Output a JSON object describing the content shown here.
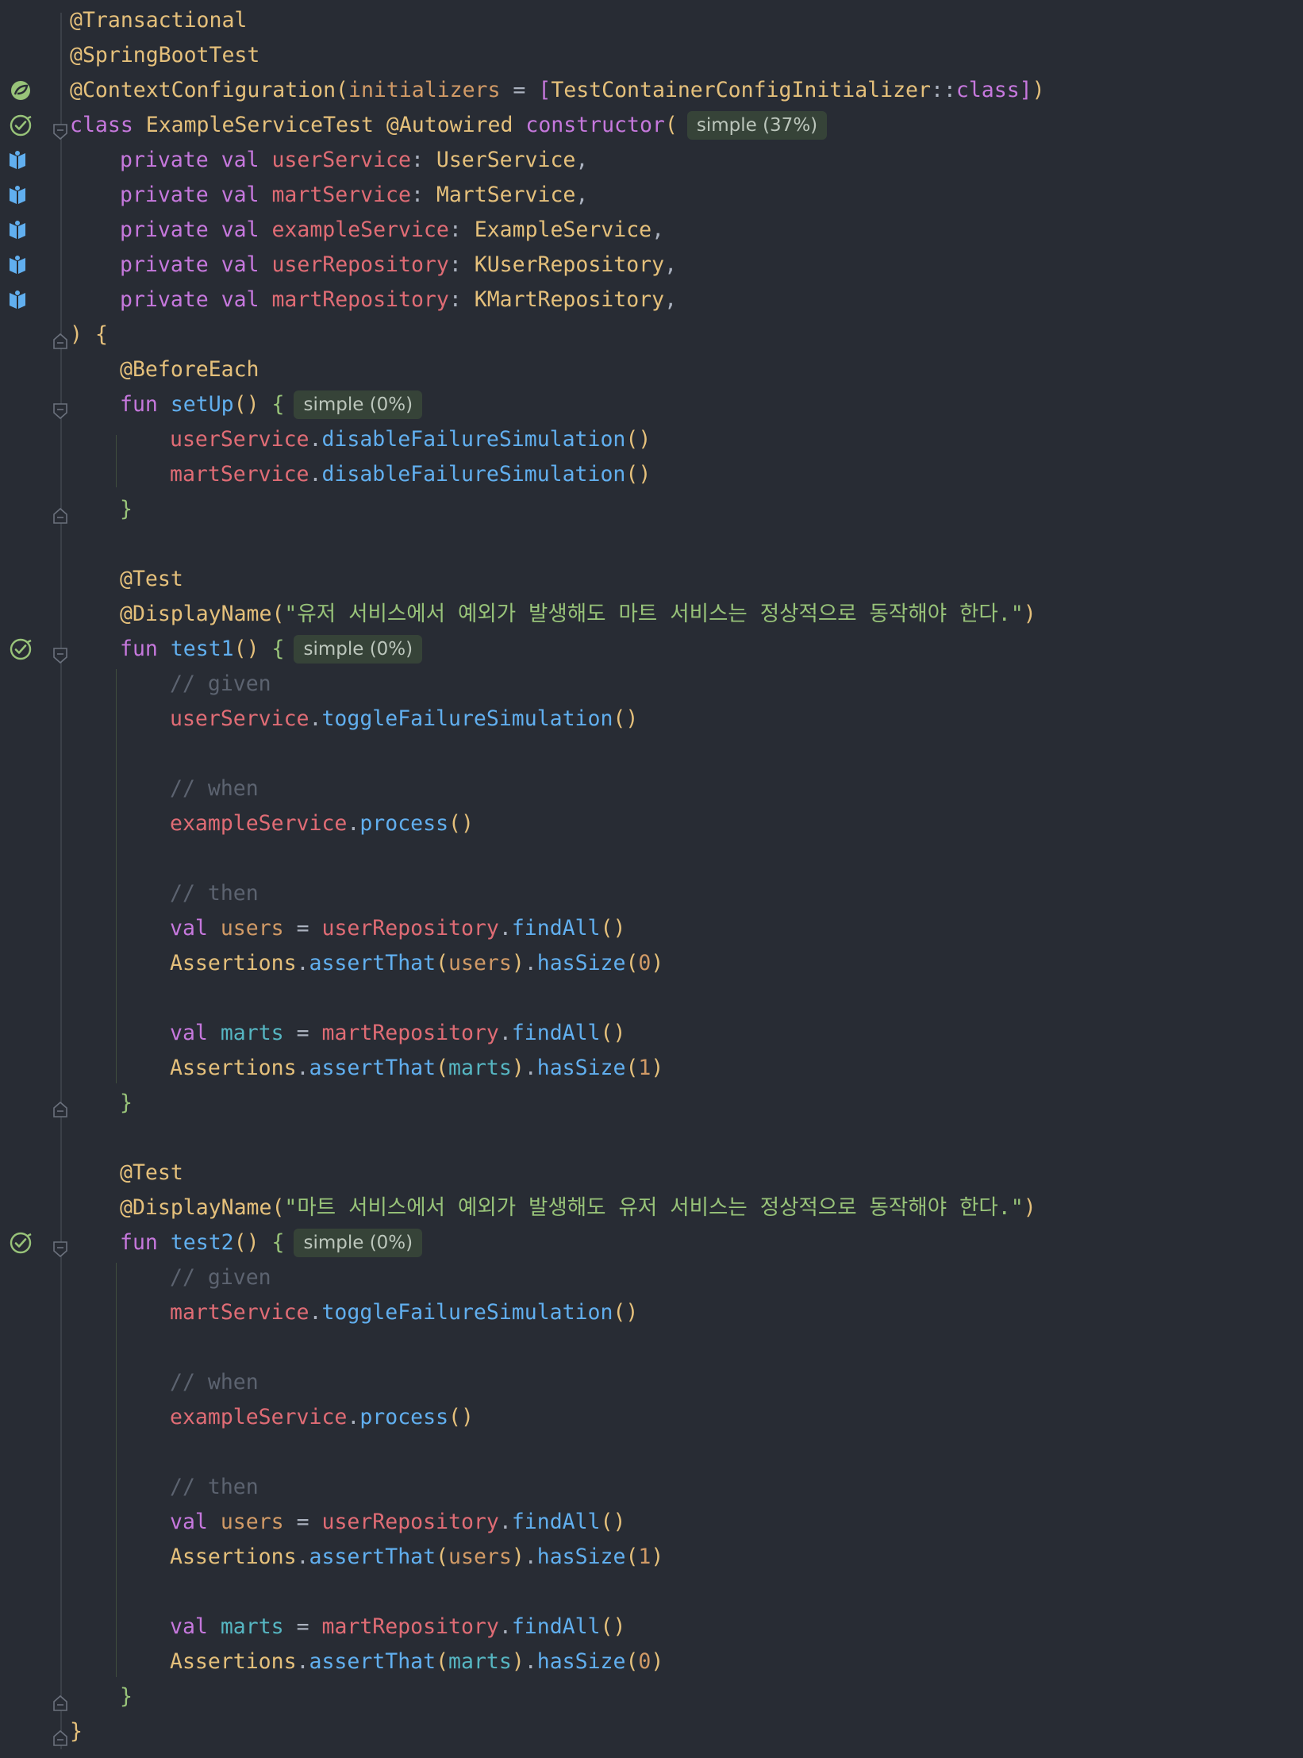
{
  "colors": {
    "background": "#282c34",
    "keyword": "#c678dd",
    "annotation": "#e5c07b",
    "type": "#e5c07b",
    "property": "#e06c75",
    "function": "#61afef",
    "string": "#98c379",
    "comment": "#5c6370",
    "number": "#d19a66",
    "plain": "#abb2bf",
    "bracket_outer": "#e5c07b",
    "bracket_inner": "#c678dd",
    "brace": "#98c379",
    "gutter_run": "#98c379",
    "gutter_inject": "#61afef"
  },
  "lines": [
    {
      "gutter": null,
      "fold": null,
      "indent": 0,
      "tokens": [
        {
          "t": "@Transactional",
          "c": "annotation"
        }
      ]
    },
    {
      "gutter": null,
      "fold": null,
      "indent": 0,
      "tokens": [
        {
          "t": "@SpringBootTest",
          "c": "annotation"
        }
      ]
    },
    {
      "gutter": "spring-bean-icon",
      "fold": null,
      "indent": 0,
      "tokens": [
        {
          "t": "@ContextConfiguration",
          "c": "annotation"
        },
        {
          "t": "(",
          "c": "bracket_outer"
        },
        {
          "t": "initializers",
          "c": "number"
        },
        {
          "t": " = ",
          "c": "plain"
        },
        {
          "t": "[",
          "c": "bracket_inner"
        },
        {
          "t": "TestContainerConfigInitializer",
          "c": "type"
        },
        {
          "t": "::",
          "c": "plain"
        },
        {
          "t": "class",
          "c": "keyword"
        },
        {
          "t": "]",
          "c": "bracket_inner"
        },
        {
          "t": ")",
          "c": "bracket_outer"
        }
      ]
    },
    {
      "gutter": "run-test-icon",
      "fold": "fold-open-icon",
      "indent": 0,
      "tokens": [
        {
          "t": "class ",
          "c": "keyword"
        },
        {
          "t": "ExampleServiceTest ",
          "c": "type"
        },
        {
          "t": "@Autowired ",
          "c": "annotation"
        },
        {
          "t": "constructor",
          "c": "keyword"
        },
        {
          "t": "(",
          "c": "bracket_outer"
        }
      ],
      "hint": "simple (37%)"
    },
    {
      "gutter": "autowired-icon",
      "fold": null,
      "indent": 1,
      "tokens": [
        {
          "t": "private val ",
          "c": "keyword"
        },
        {
          "t": "userService",
          "c": "property"
        },
        {
          "t": ": ",
          "c": "plain"
        },
        {
          "t": "UserService",
          "c": "type"
        },
        {
          "t": ",",
          "c": "plain"
        }
      ]
    },
    {
      "gutter": "autowired-icon",
      "fold": null,
      "indent": 1,
      "tokens": [
        {
          "t": "private val ",
          "c": "keyword"
        },
        {
          "t": "martService",
          "c": "property"
        },
        {
          "t": ": ",
          "c": "plain"
        },
        {
          "t": "MartService",
          "c": "type"
        },
        {
          "t": ",",
          "c": "plain"
        }
      ]
    },
    {
      "gutter": "autowired-icon",
      "fold": null,
      "indent": 1,
      "tokens": [
        {
          "t": "private val ",
          "c": "keyword"
        },
        {
          "t": "exampleService",
          "c": "property"
        },
        {
          "t": ": ",
          "c": "plain"
        },
        {
          "t": "ExampleService",
          "c": "type"
        },
        {
          "t": ",",
          "c": "plain"
        }
      ]
    },
    {
      "gutter": "autowired-icon",
      "fold": null,
      "indent": 1,
      "tokens": [
        {
          "t": "private val ",
          "c": "keyword"
        },
        {
          "t": "userRepository",
          "c": "property"
        },
        {
          "t": ": ",
          "c": "plain"
        },
        {
          "t": "KUserRepository",
          "c": "type"
        },
        {
          "t": ",",
          "c": "plain"
        }
      ]
    },
    {
      "gutter": "autowired-icon",
      "fold": null,
      "indent": 1,
      "tokens": [
        {
          "t": "private val ",
          "c": "keyword"
        },
        {
          "t": "martRepository",
          "c": "property"
        },
        {
          "t": ": ",
          "c": "plain"
        },
        {
          "t": "KMartRepository",
          "c": "type"
        },
        {
          "t": ",",
          "c": "plain"
        }
      ]
    },
    {
      "gutter": null,
      "fold": "fold-close-icon",
      "indent": 0,
      "tokens": [
        {
          "t": ")",
          "c": "bracket_outer"
        },
        {
          "t": " ",
          "c": "plain"
        },
        {
          "t": "{",
          "c": "bracket_outer"
        }
      ]
    },
    {
      "gutter": null,
      "fold": null,
      "indent": 1,
      "tokens": [
        {
          "t": "@BeforeEach",
          "c": "annotation"
        }
      ]
    },
    {
      "gutter": null,
      "fold": "fold-open-icon",
      "indent": 1,
      "tokens": [
        {
          "t": "fun ",
          "c": "keyword"
        },
        {
          "t": "setUp",
          "c": "function"
        },
        {
          "t": "()",
          "c": "bracket_outer"
        },
        {
          "t": " ",
          "c": "plain"
        },
        {
          "t": "{",
          "c": "brace"
        }
      ],
      "hint": "simple (0%)"
    },
    {
      "gutter": null,
      "fold": null,
      "indent": 2,
      "tokens": [
        {
          "t": "userService",
          "c": "property"
        },
        {
          "t": ".",
          "c": "plain"
        },
        {
          "t": "disableFailureSimulation",
          "c": "function"
        },
        {
          "t": "()",
          "c": "bracket_outer"
        }
      ]
    },
    {
      "gutter": null,
      "fold": null,
      "indent": 2,
      "tokens": [
        {
          "t": "martService",
          "c": "property"
        },
        {
          "t": ".",
          "c": "plain"
        },
        {
          "t": "disableFailureSimulation",
          "c": "function"
        },
        {
          "t": "()",
          "c": "bracket_outer"
        }
      ]
    },
    {
      "gutter": null,
      "fold": "fold-close-icon",
      "indent": 1,
      "tokens": [
        {
          "t": "}",
          "c": "brace"
        }
      ]
    },
    {
      "gutter": null,
      "fold": null,
      "indent": 0,
      "tokens": []
    },
    {
      "gutter": null,
      "fold": null,
      "indent": 1,
      "tokens": [
        {
          "t": "@Test",
          "c": "annotation"
        }
      ]
    },
    {
      "gutter": null,
      "fold": null,
      "indent": 1,
      "tokens": [
        {
          "t": "@DisplayName",
          "c": "annotation"
        },
        {
          "t": "(",
          "c": "bracket_outer"
        },
        {
          "t": "\"유저 서비스에서 예외가 발생해도 마트 서비스는 정상적으로 동작해야 한다.\"",
          "c": "string"
        },
        {
          "t": ")",
          "c": "bracket_outer"
        }
      ]
    },
    {
      "gutter": "run-test-icon",
      "fold": "fold-open-icon",
      "indent": 1,
      "tokens": [
        {
          "t": "fun ",
          "c": "keyword"
        },
        {
          "t": "test1",
          "c": "function"
        },
        {
          "t": "()",
          "c": "bracket_outer"
        },
        {
          "t": " ",
          "c": "plain"
        },
        {
          "t": "{",
          "c": "brace"
        }
      ],
      "hint": "simple (0%)"
    },
    {
      "gutter": null,
      "fold": null,
      "indent": 2,
      "tokens": [
        {
          "t": "// given",
          "c": "comment"
        }
      ]
    },
    {
      "gutter": null,
      "fold": null,
      "indent": 2,
      "tokens": [
        {
          "t": "userService",
          "c": "property"
        },
        {
          "t": ".",
          "c": "plain"
        },
        {
          "t": "toggleFailureSimulation",
          "c": "function"
        },
        {
          "t": "()",
          "c": "bracket_outer"
        }
      ]
    },
    {
      "gutter": null,
      "fold": null,
      "indent": 0,
      "tokens": []
    },
    {
      "gutter": null,
      "fold": null,
      "indent": 2,
      "tokens": [
        {
          "t": "// when",
          "c": "comment"
        }
      ]
    },
    {
      "gutter": null,
      "fold": null,
      "indent": 2,
      "tokens": [
        {
          "t": "exampleService",
          "c": "property"
        },
        {
          "t": ".",
          "c": "plain"
        },
        {
          "t": "process",
          "c": "function"
        },
        {
          "t": "()",
          "c": "bracket_outer"
        }
      ]
    },
    {
      "gutter": null,
      "fold": null,
      "indent": 0,
      "tokens": []
    },
    {
      "gutter": null,
      "fold": null,
      "indent": 2,
      "tokens": [
        {
          "t": "// then",
          "c": "comment"
        }
      ]
    },
    {
      "gutter": null,
      "fold": null,
      "indent": 2,
      "tokens": [
        {
          "t": "val ",
          "c": "keyword"
        },
        {
          "t": "users",
          "c": "number"
        },
        {
          "t": " = ",
          "c": "plain"
        },
        {
          "t": "userRepository",
          "c": "property"
        },
        {
          "t": ".",
          "c": "plain"
        },
        {
          "t": "findAll",
          "c": "function"
        },
        {
          "t": "()",
          "c": "bracket_outer"
        }
      ]
    },
    {
      "gutter": null,
      "fold": null,
      "indent": 2,
      "tokens": [
        {
          "t": "Assertions",
          "c": "type"
        },
        {
          "t": ".",
          "c": "plain"
        },
        {
          "t": "assertThat",
          "c": "function"
        },
        {
          "t": "(",
          "c": "bracket_outer"
        },
        {
          "t": "users",
          "c": "number"
        },
        {
          "t": ")",
          "c": "bracket_outer"
        },
        {
          "t": ".",
          "c": "plain"
        },
        {
          "t": "hasSize",
          "c": "function"
        },
        {
          "t": "(",
          "c": "bracket_outer"
        },
        {
          "t": "0",
          "c": "number"
        },
        {
          "t": ")",
          "c": "bracket_outer"
        }
      ]
    },
    {
      "gutter": null,
      "fold": null,
      "indent": 0,
      "tokens": []
    },
    {
      "gutter": null,
      "fold": null,
      "indent": 2,
      "tokens": [
        {
          "t": "val ",
          "c": "keyword"
        },
        {
          "t": "marts",
          "c": "teal"
        },
        {
          "t": " = ",
          "c": "plain"
        },
        {
          "t": "martRepository",
          "c": "property"
        },
        {
          "t": ".",
          "c": "plain"
        },
        {
          "t": "findAll",
          "c": "function"
        },
        {
          "t": "()",
          "c": "bracket_outer"
        }
      ]
    },
    {
      "gutter": null,
      "fold": null,
      "indent": 2,
      "tokens": [
        {
          "t": "Assertions",
          "c": "type"
        },
        {
          "t": ".",
          "c": "plain"
        },
        {
          "t": "assertThat",
          "c": "function"
        },
        {
          "t": "(",
          "c": "bracket_outer"
        },
        {
          "t": "marts",
          "c": "teal"
        },
        {
          "t": ")",
          "c": "bracket_outer"
        },
        {
          "t": ".",
          "c": "plain"
        },
        {
          "t": "hasSize",
          "c": "function"
        },
        {
          "t": "(",
          "c": "bracket_outer"
        },
        {
          "t": "1",
          "c": "number"
        },
        {
          "t": ")",
          "c": "bracket_outer"
        }
      ]
    },
    {
      "gutter": null,
      "fold": "fold-close-icon",
      "indent": 1,
      "tokens": [
        {
          "t": "}",
          "c": "brace"
        }
      ]
    },
    {
      "gutter": null,
      "fold": null,
      "indent": 0,
      "tokens": []
    },
    {
      "gutter": null,
      "fold": null,
      "indent": 1,
      "tokens": [
        {
          "t": "@Test",
          "c": "annotation"
        }
      ]
    },
    {
      "gutter": null,
      "fold": null,
      "indent": 1,
      "tokens": [
        {
          "t": "@DisplayName",
          "c": "annotation"
        },
        {
          "t": "(",
          "c": "bracket_outer"
        },
        {
          "t": "\"마트 서비스에서 예외가 발생해도 유저 서비스는 정상적으로 동작해야 한다.\"",
          "c": "string"
        },
        {
          "t": ")",
          "c": "bracket_outer"
        }
      ]
    },
    {
      "gutter": "run-test-icon",
      "fold": "fold-open-icon",
      "indent": 1,
      "tokens": [
        {
          "t": "fun ",
          "c": "keyword"
        },
        {
          "t": "test2",
          "c": "function"
        },
        {
          "t": "()",
          "c": "bracket_outer"
        },
        {
          "t": " ",
          "c": "plain"
        },
        {
          "t": "{",
          "c": "brace"
        }
      ],
      "hint": "simple (0%)"
    },
    {
      "gutter": null,
      "fold": null,
      "indent": 2,
      "tokens": [
        {
          "t": "// given",
          "c": "comment"
        }
      ]
    },
    {
      "gutter": null,
      "fold": null,
      "indent": 2,
      "tokens": [
        {
          "t": "martService",
          "c": "property"
        },
        {
          "t": ".",
          "c": "plain"
        },
        {
          "t": "toggleFailureSimulation",
          "c": "function"
        },
        {
          "t": "()",
          "c": "bracket_outer"
        }
      ]
    },
    {
      "gutter": null,
      "fold": null,
      "indent": 0,
      "tokens": []
    },
    {
      "gutter": null,
      "fold": null,
      "indent": 2,
      "tokens": [
        {
          "t": "// when",
          "c": "comment"
        }
      ]
    },
    {
      "gutter": null,
      "fold": null,
      "indent": 2,
      "tokens": [
        {
          "t": "exampleService",
          "c": "property"
        },
        {
          "t": ".",
          "c": "plain"
        },
        {
          "t": "process",
          "c": "function"
        },
        {
          "t": "()",
          "c": "bracket_outer"
        }
      ]
    },
    {
      "gutter": null,
      "fold": null,
      "indent": 0,
      "tokens": []
    },
    {
      "gutter": null,
      "fold": null,
      "indent": 2,
      "tokens": [
        {
          "t": "// then",
          "c": "comment"
        }
      ]
    },
    {
      "gutter": null,
      "fold": null,
      "indent": 2,
      "tokens": [
        {
          "t": "val ",
          "c": "keyword"
        },
        {
          "t": "users",
          "c": "number"
        },
        {
          "t": " = ",
          "c": "plain"
        },
        {
          "t": "userRepository",
          "c": "property"
        },
        {
          "t": ".",
          "c": "plain"
        },
        {
          "t": "findAll",
          "c": "function"
        },
        {
          "t": "()",
          "c": "bracket_outer"
        }
      ]
    },
    {
      "gutter": null,
      "fold": null,
      "indent": 2,
      "tokens": [
        {
          "t": "Assertions",
          "c": "type"
        },
        {
          "t": ".",
          "c": "plain"
        },
        {
          "t": "assertThat",
          "c": "function"
        },
        {
          "t": "(",
          "c": "bracket_outer"
        },
        {
          "t": "users",
          "c": "number"
        },
        {
          "t": ")",
          "c": "bracket_outer"
        },
        {
          "t": ".",
          "c": "plain"
        },
        {
          "t": "hasSize",
          "c": "function"
        },
        {
          "t": "(",
          "c": "bracket_outer"
        },
        {
          "t": "1",
          "c": "number"
        },
        {
          "t": ")",
          "c": "bracket_outer"
        }
      ]
    },
    {
      "gutter": null,
      "fold": null,
      "indent": 0,
      "tokens": []
    },
    {
      "gutter": null,
      "fold": null,
      "indent": 2,
      "tokens": [
        {
          "t": "val ",
          "c": "keyword"
        },
        {
          "t": "marts",
          "c": "teal"
        },
        {
          "t": " = ",
          "c": "plain"
        },
        {
          "t": "martRepository",
          "c": "property"
        },
        {
          "t": ".",
          "c": "plain"
        },
        {
          "t": "findAll",
          "c": "function"
        },
        {
          "t": "()",
          "c": "bracket_outer"
        }
      ]
    },
    {
      "gutter": null,
      "fold": null,
      "indent": 2,
      "tokens": [
        {
          "t": "Assertions",
          "c": "type"
        },
        {
          "t": ".",
          "c": "plain"
        },
        {
          "t": "assertThat",
          "c": "function"
        },
        {
          "t": "(",
          "c": "bracket_outer"
        },
        {
          "t": "marts",
          "c": "teal"
        },
        {
          "t": ")",
          "c": "bracket_outer"
        },
        {
          "t": ".",
          "c": "plain"
        },
        {
          "t": "hasSize",
          "c": "function"
        },
        {
          "t": "(",
          "c": "bracket_outer"
        },
        {
          "t": "0",
          "c": "number"
        },
        {
          "t": ")",
          "c": "bracket_outer"
        }
      ]
    },
    {
      "gutter": null,
      "fold": "fold-close-icon",
      "indent": 1,
      "tokens": [
        {
          "t": "}",
          "c": "brace"
        }
      ]
    },
    {
      "gutter": null,
      "fold": "fold-close-icon",
      "indent": 0,
      "tokens": [
        {
          "t": "}",
          "c": "bracket_outer"
        }
      ]
    }
  ]
}
